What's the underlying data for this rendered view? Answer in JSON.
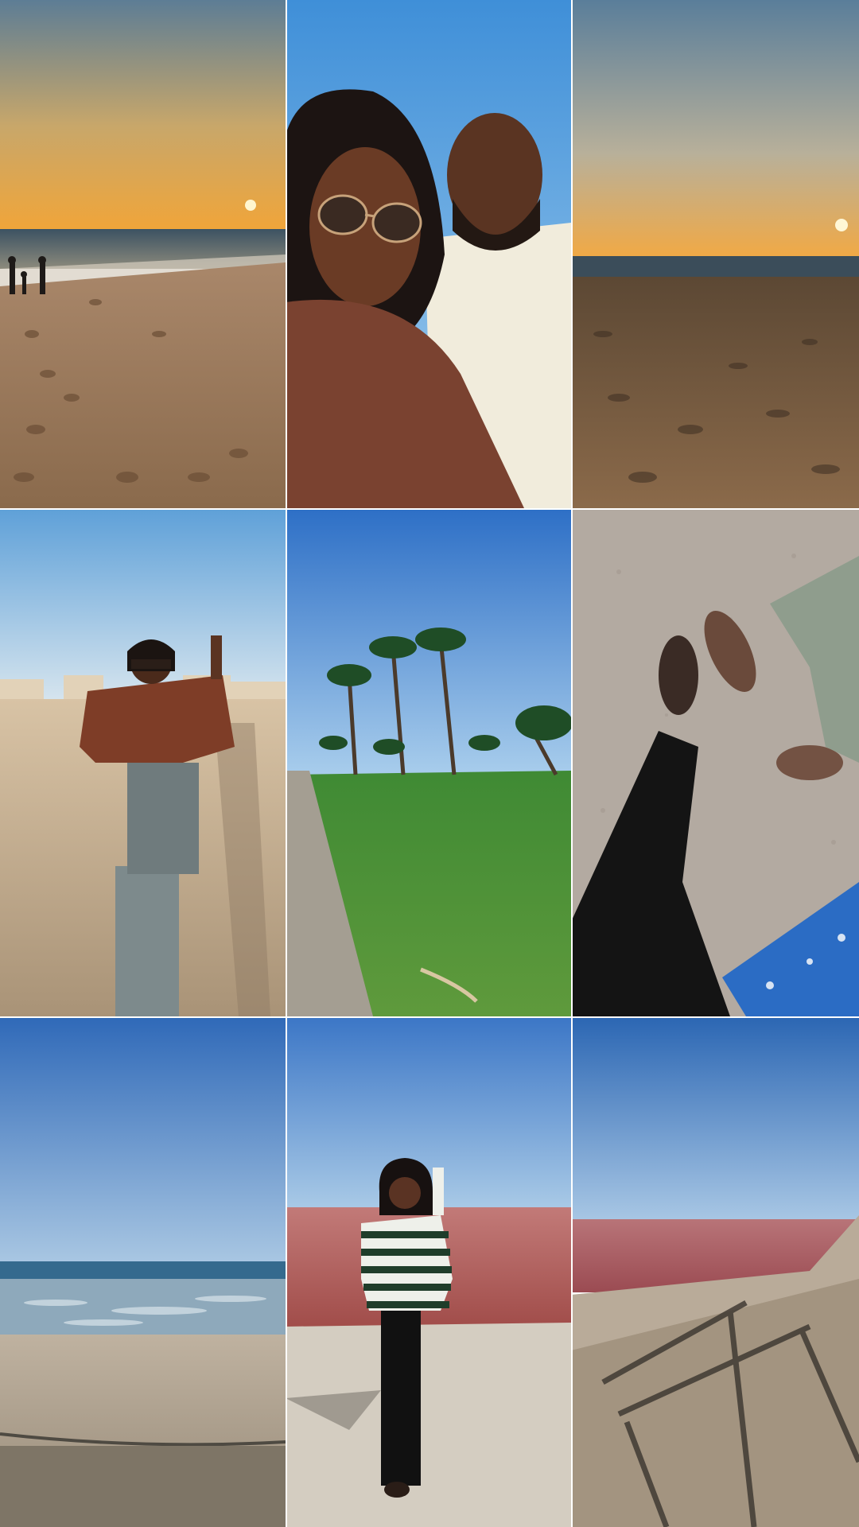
{
  "collage": {
    "photos": [
      {
        "subject": "beach-sunset-footprints"
      },
      {
        "subject": "couple-selfie"
      },
      {
        "subject": "beach-sunset-sand"
      },
      {
        "subject": "woman-peace-sign-beach"
      },
      {
        "subject": "palm-trees-park"
      },
      {
        "subject": "legs-on-bench"
      },
      {
        "subject": "beach-blue-sky"
      },
      {
        "subject": "woman-pink-lagoon"
      },
      {
        "subject": "pink-lagoon-rocks"
      }
    ]
  }
}
